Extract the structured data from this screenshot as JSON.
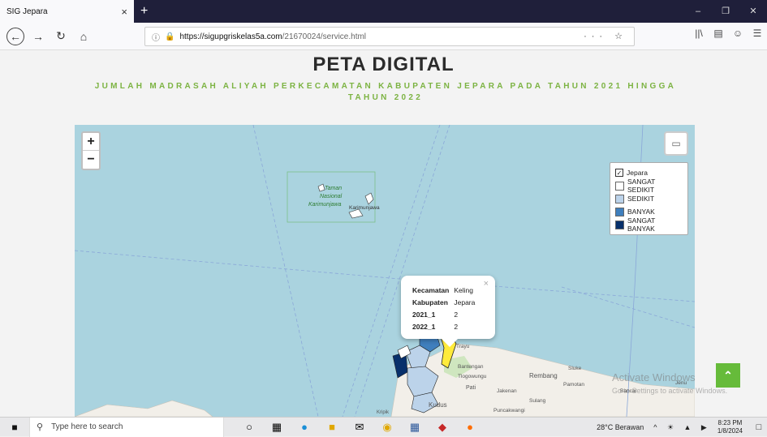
{
  "browser": {
    "tab_title": "SIG Jepara",
    "tab_close": "×",
    "new_tab": "+",
    "url_domain": "https://sigupgriskelas5a.com",
    "url_path": "/21670024/service.html",
    "url_actions": "··· ☆"
  },
  "page": {
    "title": "PETA DIGITAL",
    "subtitle": "JUMLAH MADRASAH ALIYAH PERKECAMATAN KABUPATEN JEPARA PADA TAHUN 2021 HINGGA TAHUN 2022"
  },
  "map": {
    "zoom_in": "+",
    "zoom_out": "−",
    "legend": {
      "layer_name": "Jepara",
      "items": [
        {
          "label": "SANGAT SEDIKIT",
          "color": "#ffffff"
        },
        {
          "label": "SEDIKIT",
          "color": "#bcd3ea"
        },
        {
          "label": "BANYAK",
          "color": "#3f7fbd"
        },
        {
          "label": "SANGAT BANYAK",
          "color": "#08306b"
        }
      ]
    },
    "place_labels": {
      "taman": "Taman",
      "nasional": "Nasional",
      "karimunjawa": "Karimunjawa",
      "kemujan": "Karimunjawa",
      "trayu": "Trayu",
      "bantengan": "Bantengan",
      "tlogowungu": "Tlogowungu",
      "pati": "Pati",
      "jakenan": "Jakenan",
      "rembang": "Rembang",
      "sluke": "Sluke",
      "pamotan": "Pamotan",
      "bancar": "Bancar",
      "jenu": "Jenu",
      "sulang": "Sulang",
      "kudus": "Kudus",
      "kripik": "Kripik",
      "puncakwangi": "Puncakwangi"
    },
    "popup": {
      "rows": [
        {
          "key": "Kecamatan",
          "value": "Keling"
        },
        {
          "key": "Kabupaten",
          "value": "Jepara"
        },
        {
          "key": "2021_1",
          "value": "2"
        },
        {
          "key": "2022_1",
          "value": "2"
        }
      ],
      "close": "×"
    }
  },
  "overlay": {
    "activate_title": "Activate Windows",
    "activate_sub": "Go to Settings to activate Windows."
  },
  "taskbar": {
    "search_placeholder": "Type here to search",
    "weather": "28°C  Berawan",
    "time": "8:23 PM",
    "date": "1/8/2024"
  }
}
